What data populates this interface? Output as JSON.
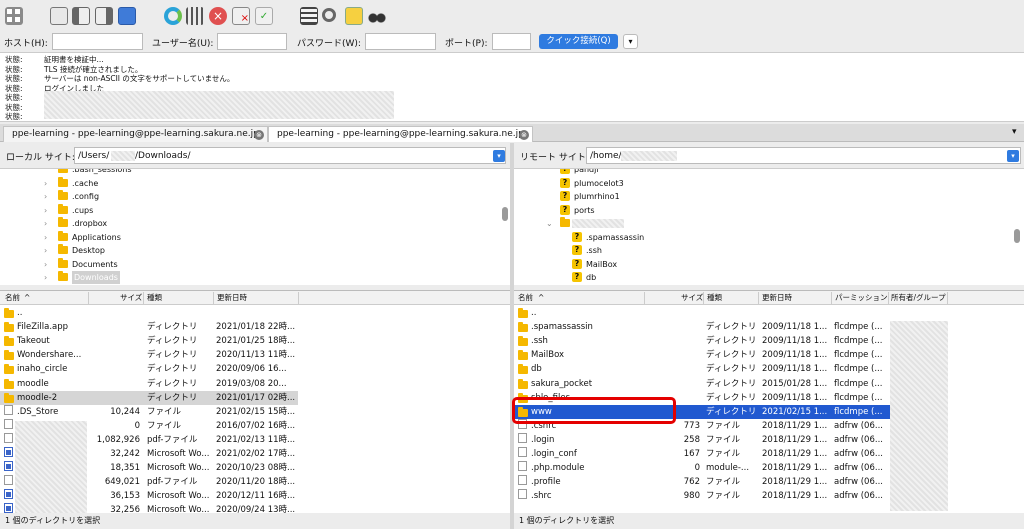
{
  "toolbar": {
    "icons": [
      "site-manager-icon",
      "log-toggle-icon",
      "tree-toggle-local-icon",
      "tree-toggle-remote-icon",
      "queue-toggle-icon",
      "refresh-icon",
      "process-queue-icon",
      "cancel-icon",
      "disconnect-icon",
      "reconnect-icon",
      "filter-icon",
      "search-icon",
      "compare-icon",
      "find-icon"
    ]
  },
  "quickconnect": {
    "host_label": "ホスト(H):",
    "user_label": "ユーザー名(U):",
    "pass_label": "パスワード(W):",
    "port_label": "ポート(P):",
    "button_label": "クイック接続(Q)",
    "host_value": "",
    "user_value": "",
    "pass_value": "",
    "port_value": ""
  },
  "log": [
    {
      "k": "状態:",
      "m": "証明書を検証中..."
    },
    {
      "k": "状態:",
      "m": "TLS 接続が確立されました。"
    },
    {
      "k": "状態:",
      "m": "サーバーは non-ASCII の文字をサポートしていません。"
    },
    {
      "k": "状態:",
      "m": "ログインしました"
    },
    {
      "k": "状態:",
      "m": ""
    },
    {
      "k": "状態:",
      "m": ""
    },
    {
      "k": "状態:",
      "m": ""
    }
  ],
  "tabs": [
    {
      "label": "ppe-learning - ppe-learning@ppe-learning.sakura.ne.jp",
      "close": "⊗"
    },
    {
      "label": "ppe-learning - ppe-learning@ppe-learning.sakura.ne.jp",
      "close": "⊗"
    }
  ],
  "tab_more": "▾",
  "local": {
    "site_label": "ローカル サイト:",
    "path_a": "/Users/",
    "path_b": "/Downloads/",
    "tree": [
      ".bash_sessions",
      ".cache",
      ".config",
      ".cups",
      ".dropbox",
      "Applications",
      "Desktop",
      "Documents",
      "Downloads"
    ],
    "headers": {
      "name": "名前",
      "size": "サイズ",
      "type": "種類",
      "modified": "更新日時"
    },
    "rows": [
      {
        "name": "..",
        "size": "",
        "type": "",
        "date": "",
        "icon": "folder"
      },
      {
        "name": "FileZilla.app",
        "size": "",
        "type": "ディレクトリ",
        "date": "2021/01/18 22時...",
        "icon": "folder"
      },
      {
        "name": "Takeout",
        "size": "",
        "type": "ディレクトリ",
        "date": "2021/01/25 18時...",
        "icon": "folder"
      },
      {
        "name": "Wondershare...",
        "size": "",
        "type": "ディレクトリ",
        "date": "2020/11/13 11時...",
        "icon": "folder"
      },
      {
        "name": "inaho_circle",
        "size": "",
        "type": "ディレクトリ",
        "date": "2020/09/06 16...",
        "icon": "folder"
      },
      {
        "name": "moodle",
        "size": "",
        "type": "ディレクトリ",
        "date": "2019/03/08 20...",
        "icon": "folder"
      },
      {
        "name": "moodle-2",
        "size": "",
        "type": "ディレクトリ",
        "date": "2021/01/17 02時...",
        "icon": "folder",
        "selected": true
      },
      {
        "name": ".DS_Store",
        "size": "10,244",
        "type": "ファイル",
        "date": "2021/02/15 15時...",
        "icon": "file"
      },
      {
        "name": "",
        "size": "0",
        "type": "ファイル",
        "date": "2016/07/02 16時...",
        "icon": "file"
      },
      {
        "name": "",
        "size": "1,082,926",
        "type": "pdf-ファイル",
        "date": "2021/02/13 11時...",
        "icon": "pdf"
      },
      {
        "name": "",
        "size": "32,242",
        "type": "Microsoft Wo...",
        "date": "2021/02/02 17時...",
        "icon": "word"
      },
      {
        "name": "",
        "size": "18,351",
        "type": "Microsoft Wo...",
        "date": "2020/10/23 08時...",
        "icon": "word"
      },
      {
        "name": "",
        "size": "649,021",
        "type": "pdf-ファイル",
        "date": "2020/11/20 18時...",
        "icon": "pdf"
      },
      {
        "name": "",
        "size": "36,153",
        "type": "Microsoft Wo...",
        "date": "2020/12/11 16時...",
        "icon": "word"
      },
      {
        "name": "",
        "size": "32,256",
        "type": "Microsoft Wo...",
        "date": "2020/09/24 13時...",
        "icon": "word"
      }
    ],
    "status": "1 個のディレクトリを選択"
  },
  "remote": {
    "site_label": "リモート サイト:",
    "path": "/home/",
    "tree": [
      "pandji",
      "plumocelot3",
      "plumrhino1",
      "ports",
      "",
      ".spamassassin",
      ".ssh",
      "MailBox",
      "db"
    ],
    "headers": {
      "name": "名前",
      "size": "サイズ",
      "type": "種類",
      "modified": "更新日時",
      "perm": "パーミッション",
      "owner": "所有者/グループ"
    },
    "rows": [
      {
        "name": "..",
        "size": "",
        "type": "",
        "date": "",
        "perm": "",
        "icon": "folder"
      },
      {
        "name": ".spamassassin",
        "size": "",
        "type": "ディレクトリ",
        "date": "2009/11/18 1...",
        "perm": "flcdmpe (...",
        "icon": "folder"
      },
      {
        "name": ".ssh",
        "size": "",
        "type": "ディレクトリ",
        "date": "2009/11/18 1...",
        "perm": "flcdmpe (...",
        "icon": "folder"
      },
      {
        "name": "MailBox",
        "size": "",
        "type": "ディレクトリ",
        "date": "2009/11/18 1...",
        "perm": "flcdmpe (...",
        "icon": "folder"
      },
      {
        "name": "db",
        "size": "",
        "type": "ディレクトリ",
        "date": "2009/11/18 1...",
        "perm": "flcdmpe (...",
        "icon": "folder"
      },
      {
        "name": "sakura_pocket",
        "size": "",
        "type": "ディレクトリ",
        "date": "2015/01/28 1...",
        "perm": "flcdmpe (...",
        "icon": "folder"
      },
      {
        "name": "sblo_files",
        "size": "",
        "type": "ディレクトリ",
        "date": "2009/11/18 1...",
        "perm": "flcdmpe (...",
        "icon": "folder"
      },
      {
        "name": "www",
        "size": "",
        "type": "ディレクトリ",
        "date": "2021/02/15 1...",
        "perm": "flcdmpe (...",
        "icon": "folder",
        "selected": true
      },
      {
        "name": ".cshrc",
        "size": "773",
        "type": "ファイル",
        "date": "2018/11/29 1...",
        "perm": "adfrw (06...",
        "icon": "file"
      },
      {
        "name": ".login",
        "size": "258",
        "type": "ファイル",
        "date": "2018/11/29 1...",
        "perm": "adfrw (06...",
        "icon": "file"
      },
      {
        "name": ".login_conf",
        "size": "167",
        "type": "ファイル",
        "date": "2018/11/29 1...",
        "perm": "adfrw (06...",
        "icon": "file"
      },
      {
        "name": ".php.module",
        "size": "0",
        "type": "module-...",
        "date": "2018/11/29 1...",
        "perm": "adfrw (06...",
        "icon": "file"
      },
      {
        "name": ".profile",
        "size": "762",
        "type": "ファイル",
        "date": "2018/11/29 1...",
        "perm": "adfrw (06...",
        "icon": "file"
      },
      {
        "name": ".shrc",
        "size": "980",
        "type": "ファイル",
        "date": "2018/11/29 1...",
        "perm": "adfrw (06...",
        "icon": "file"
      }
    ],
    "status": "1 個のディレクトリを選択"
  }
}
